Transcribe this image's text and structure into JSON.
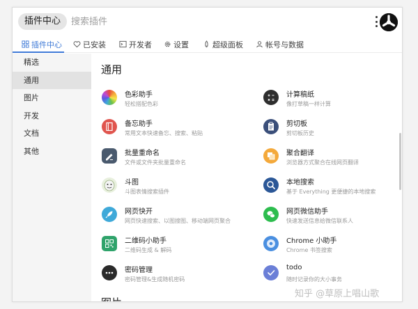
{
  "header": {
    "tag": "插件中心",
    "search_placeholder": "搜索插件"
  },
  "tabs": [
    {
      "label": "插件中心",
      "icon": "grid-icon"
    },
    {
      "label": "已安装",
      "icon": "heart-icon"
    },
    {
      "label": "开发者",
      "icon": "terminal-icon"
    },
    {
      "label": "设置",
      "icon": "gear-icon"
    },
    {
      "label": "超级面板",
      "icon": "rocket-icon"
    },
    {
      "label": "帐号与数据",
      "icon": "user-icon"
    }
  ],
  "sidebar": {
    "items": [
      {
        "label": "精选"
      },
      {
        "label": "通用"
      },
      {
        "label": "图片"
      },
      {
        "label": "开发"
      },
      {
        "label": "文档"
      },
      {
        "label": "其他"
      }
    ]
  },
  "section": {
    "title": "通用",
    "next_title": "图片"
  },
  "plugins": [
    {
      "title": "色彩助手",
      "desc": "轻松搭配色彩",
      "icon": "color-wheel-icon",
      "color": "#e84b3c"
    },
    {
      "title": "计算稿纸",
      "desc": "像打草稿一样计算",
      "icon": "calculator-icon",
      "color": "#2e2e2e"
    },
    {
      "title": "备忘助手",
      "desc": "常用文本快速备忘、搜索、粘贴",
      "icon": "notebook-icon",
      "color": "#e0554e"
    },
    {
      "title": "剪切板",
      "desc": "剪切板历史",
      "icon": "clipboard-icon",
      "color": "#3b4f7a"
    },
    {
      "title": "批量重命名",
      "desc": "文件或文件夹批量重命名",
      "icon": "rename-icon",
      "color": "#4a5a6e"
    },
    {
      "title": "聚合翻译",
      "desc": "浏览器方式聚合在线网页翻译",
      "icon": "translate-icon",
      "color": "#f4a93b"
    },
    {
      "title": "斗图",
      "desc": "斗图表情搜索插件",
      "icon": "meme-icon",
      "color": "#8ec07c"
    },
    {
      "title": "本地搜索",
      "desc": "基于 Everything 更便捷的本地搜索",
      "icon": "local-search-icon",
      "color": "#2b5797"
    },
    {
      "title": "网页快开",
      "desc": "网页快速搜索、以图搜图、移动端网页聚合",
      "icon": "rocket-icon",
      "color": "#3fa9d9"
    },
    {
      "title": "网页微信助手",
      "desc": "快速发送信息给微信联系人",
      "icon": "wechat-icon",
      "color": "#2dbd4e"
    },
    {
      "title": "二维码小助手",
      "desc": "二维码生成 & 解码",
      "icon": "qrcode-icon",
      "color": "#2fa36b"
    },
    {
      "title": "Chrome 小助手",
      "desc": "Chrome 书签搜索",
      "icon": "chrome-icon",
      "color": "#4a8fe0"
    },
    {
      "title": "密码管理",
      "desc": "密码管理&生成随机密码",
      "icon": "password-icon",
      "color": "#2a2a2a"
    },
    {
      "title": "todo",
      "desc": "随时记录你的大小事务",
      "icon": "todo-check-icon",
      "color": "#6b7fd7"
    }
  ],
  "watermark": "知乎 @草原上唱山歌"
}
